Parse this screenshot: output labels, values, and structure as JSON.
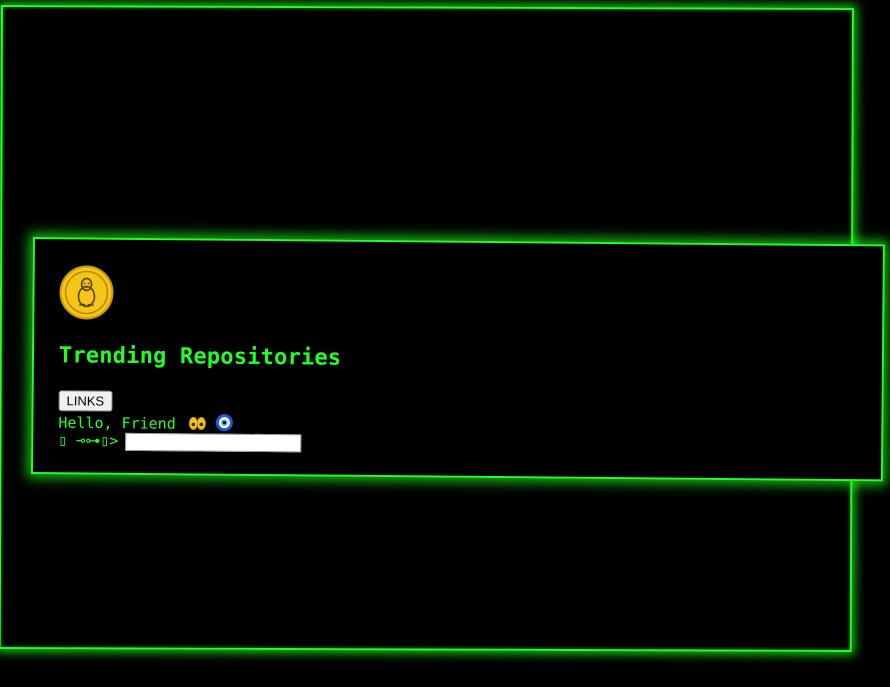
{
  "page": {
    "title": "Trending Repositories",
    "logo_icon": "tux-penguin-icon",
    "accent_color": "#22ff22",
    "background_color": "#000000"
  },
  "nav": {
    "links_button_label": "LINKS"
  },
  "greeting": {
    "text": "Hello, Friend",
    "emoji_icons": [
      "eyes-icon",
      "nazar-amulet-icon"
    ]
  },
  "prompt": {
    "text": "▯ ⊸⊶▯>",
    "input_value": "",
    "input_placeholder": ""
  }
}
